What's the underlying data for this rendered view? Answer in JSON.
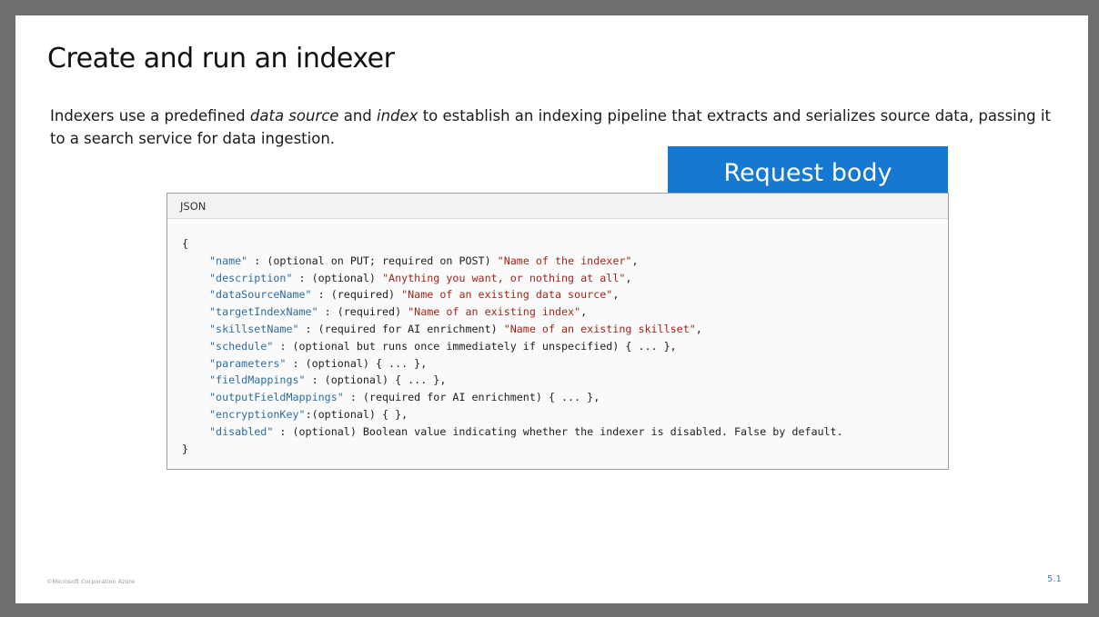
{
  "slide": {
    "title": "Create and run an indexer",
    "intro": {
      "p1": "Indexers use a predefined ",
      "em1": "data source",
      "p2": " and ",
      "em2": "index",
      "p3": " to establish an indexing pipeline that extracts and serializes source data, passing it to a search service for data ingestion."
    },
    "request_label": "Request body",
    "code_header": "JSON",
    "code": {
      "open": "{",
      "close": "}",
      "lines": [
        {
          "key": "\"name\"",
          "rest": " : (optional on PUT; required on POST) ",
          "str": "\"Name of the indexer\"",
          "tail": ","
        },
        {
          "key": "\"description\"",
          "rest": " : (optional) ",
          "str": "\"Anything you want, or nothing at all\"",
          "tail": ","
        },
        {
          "key": "\"dataSourceName\"",
          "rest": " : (required) ",
          "str": "\"Name of an existing data source\"",
          "tail": ","
        },
        {
          "key": "\"targetIndexName\"",
          "rest": " : (required) ",
          "str": "\"Name of an existing index\"",
          "tail": ","
        },
        {
          "key": "\"skillsetName\"",
          "rest": " : (required for AI enrichment) ",
          "str": "\"Name of an existing skillset\"",
          "tail": ","
        },
        {
          "key": "\"schedule\"",
          "rest": " : (optional but runs once immediately if unspecified) { ... },",
          "str": "",
          "tail": ""
        },
        {
          "key": "\"parameters\"",
          "rest": " : (optional) { ... },",
          "str": "",
          "tail": ""
        },
        {
          "key": "\"fieldMappings\"",
          "rest": " : (optional) { ... },",
          "str": "",
          "tail": ""
        },
        {
          "key": "\"outputFieldMappings\"",
          "rest": " : (required for AI enrichment) { ... },",
          "str": "",
          "tail": ""
        },
        {
          "key": "\"encryptionKey\"",
          "rest": ":(optional) { },",
          "str": "",
          "tail": ""
        },
        {
          "key": "\"disabled\"",
          "rest": " : (optional) Boolean value indicating whether the indexer is disabled. False by default.",
          "str": "",
          "tail": ""
        }
      ]
    },
    "footer_left": "©Microsoft Corporation Azure",
    "page_number": "5.1"
  }
}
